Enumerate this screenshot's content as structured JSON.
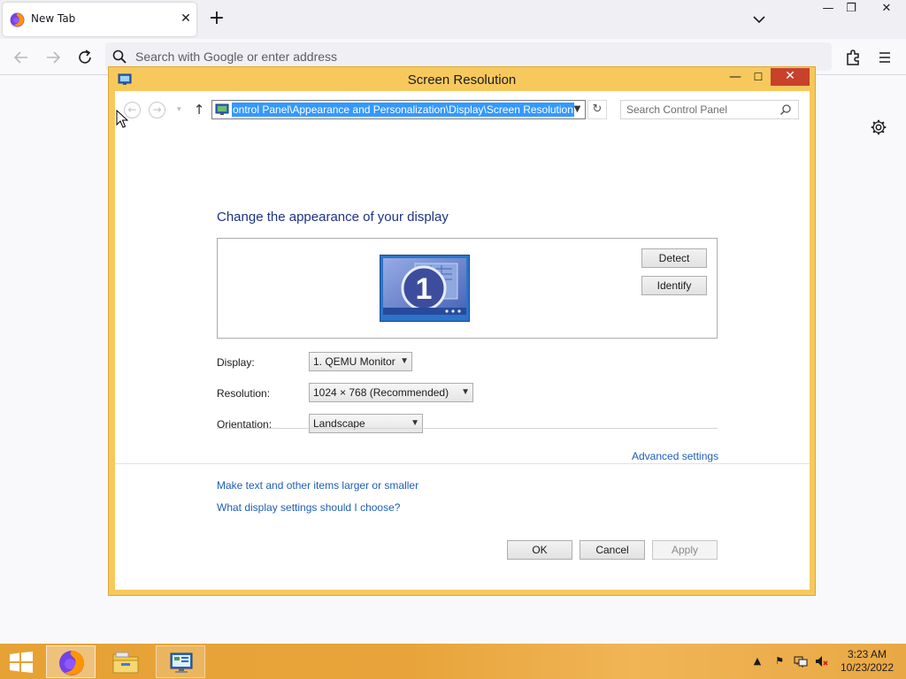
{
  "browser": {
    "tab_title": "New Tab",
    "url_placeholder": "Search with Google or enter address",
    "icons": {
      "back": "arrow-left-icon",
      "forward": "arrow-right-icon",
      "reload": "reload-icon",
      "extensions": "puzzle-icon",
      "menu": "hamburger-icon",
      "settings": "gear-icon"
    }
  },
  "dialog": {
    "title": "Screen Resolution",
    "address_path": "ontrol Panel\\Appearance and Personalization\\Display\\Screen Resolution",
    "search_placeholder": "Search Control Panel",
    "heading": "Change the appearance of your display",
    "monitor_number": "1",
    "detect_label": "Detect",
    "identify_label": "Identify",
    "display_label": "Display:",
    "display_value": "1. QEMU Monitor",
    "resolution_label": "Resolution:",
    "resolution_value": "1024 × 768 (Recommended)",
    "orientation_label": "Orientation:",
    "orientation_value": "Landscape",
    "advanced_link": "Advanced settings",
    "link_text_size": "Make text and other items larger or smaller",
    "link_which_settings": "What display settings should I choose?",
    "ok_label": "OK",
    "cancel_label": "Cancel",
    "apply_label": "Apply"
  },
  "taskbar": {
    "time": "3:23 AM",
    "date": "10/23/2022"
  },
  "colors": {
    "dialog_frame": "#f7c95d",
    "close_button": "#c7412b",
    "selection": "#3399ff",
    "heading": "#1e3287",
    "link": "#1e5eb5",
    "taskbar": "#e8a43a"
  }
}
